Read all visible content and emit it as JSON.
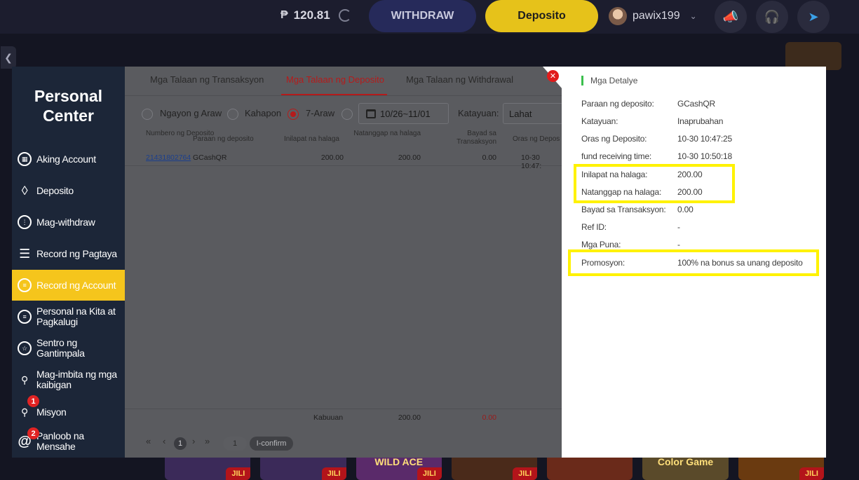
{
  "topbar": {
    "currency": "₱",
    "balance": "120.81",
    "withdraw_label": "WITHDRAW",
    "deposit_label": "Deposito",
    "username": "pawix199"
  },
  "games": [
    {
      "title": "",
      "badge": "JILI"
    },
    {
      "title": "",
      "badge": "JILI"
    },
    {
      "title": "WILD ACE",
      "badge": "JILI"
    },
    {
      "title": "",
      "badge": "JILI"
    },
    {
      "title": "",
      "badge": ""
    },
    {
      "title": "Color Game",
      "badge": ""
    },
    {
      "title": "",
      "badge": "JILI"
    }
  ],
  "sidebar": {
    "title": "Personal Center",
    "items": [
      {
        "label": "Aking Account"
      },
      {
        "label": "Deposito"
      },
      {
        "label": "Mag-withdraw"
      },
      {
        "label": "Record ng Pagtaya"
      },
      {
        "label": "Record ng Account"
      },
      {
        "label": "Personal na Kita at Pagkalugi"
      },
      {
        "label": "Sentro ng Gantimpala"
      },
      {
        "label": "Mag-imbita ng mga kaibigan"
      },
      {
        "label": "Misyon",
        "badge": "1"
      },
      {
        "label": "Panloob na Mensahe",
        "badge": "2"
      }
    ]
  },
  "tabs": [
    {
      "label": "Mga Talaan ng Transaksyon"
    },
    {
      "label": "Mga Talaan ng Deposito"
    },
    {
      "label": "Mga Talaan ng Withdrawal"
    }
  ],
  "filters": {
    "today": "Ngayon g Araw",
    "yesterday": "Kahapon",
    "seven_days": "7-Araw",
    "date_range": "10/26~11/01",
    "status_label": "Katayuan:",
    "status_value": "Lahat"
  },
  "table": {
    "headers": [
      "Numbero ng Deposito",
      "Paraan ng deposito",
      "Inilapat na halaga",
      "Natanggap na halaga",
      "Bayad sa Transaksyon",
      "Oras ng Depos"
    ],
    "rows": [
      [
        "21431802764",
        "GCashQR",
        "200.00",
        "200.00",
        "0.00",
        "10-30 10:47:"
      ]
    ],
    "footer": {
      "label": "Kabuuan",
      "total": "200.00",
      "fee": "0.00"
    }
  },
  "pagination": {
    "current": "1",
    "goto_value": "1",
    "confirm_label": "I-confirm"
  },
  "detail": {
    "title": "Mga Detalye",
    "rows": [
      {
        "label": "Paraan ng deposito:",
        "value": "GCashQR"
      },
      {
        "label": "Katayuan:",
        "value": "Inaprubahan"
      },
      {
        "label": "Oras ng Deposito:",
        "value": "10-30 10:47:25"
      },
      {
        "label": "fund receiving time:",
        "value": "10-30 10:50:18"
      },
      {
        "label": "Inilapat na halaga:",
        "value": "200.00"
      },
      {
        "label": "Natanggap na halaga:",
        "value": "200.00"
      },
      {
        "label": "Bayad sa Transaksyon:",
        "value": "0.00"
      },
      {
        "label": "Ref ID:",
        "value": "-"
      },
      {
        "label": "Mga Puna:",
        "value": "-"
      },
      {
        "label": "Promosyon:",
        "value": "100% na bonus sa unang deposito"
      }
    ]
  },
  "colors": {
    "accent_yellow": "#f5c51c",
    "active_tab_red": "#b51b1b",
    "highlight": "#fff200",
    "sidebar_bg": "#1c2638"
  }
}
